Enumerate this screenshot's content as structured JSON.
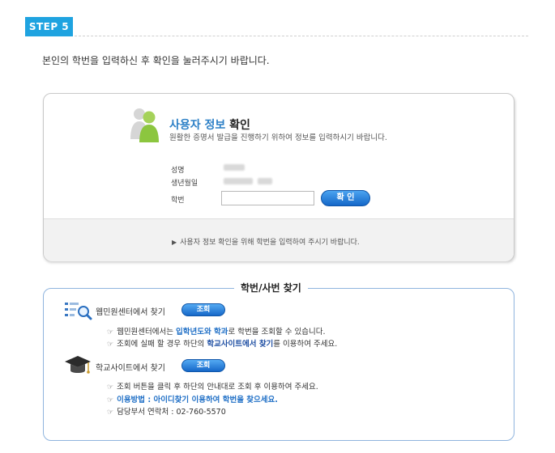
{
  "step": {
    "badge": "STEP 5"
  },
  "intro": "본인의 학번을 입력하신 후 확인을 눌러주시기 바랍니다.",
  "verify": {
    "title_blue": "사용자 정보",
    "title_dark": " 확인",
    "subtitle": "원활한 증명서 발급을 진행하기 위하여 정보를 입력하시기 바랍니다.",
    "name_label": "성명",
    "birth_label": "생년월일",
    "student_no_label": "학번",
    "confirm_button": "확 인",
    "hint": "사용자 정보 확인을 위해 학번을 입력하여 주시기 바랍니다."
  },
  "find": {
    "title": "학번/사번 찾기",
    "webmin": {
      "title": "웹민원센터에서 찾기",
      "button": "조회",
      "line1_a": "웹민원센터에서는 ",
      "line1_b": "입학년도와 학과",
      "line1_c": "로 학번을 조회할 수 있습니다.",
      "line2_a": "조회에 실패 할 경우 하단의 ",
      "line2_b": "학교사이트에서 찾기",
      "line2_c": "를 이용하여 주세요."
    },
    "school": {
      "title": "학교사이트에서 찾기",
      "button": "조회",
      "line1": "조회 버튼을 클릭 후 하단의 안내대로 조회 후 이용하여 주세요.",
      "line2": "이용방법 : 아이디찾기 이용하여 학번을 찾으세요.",
      "line3": "담당부서 연락처 : 02-760-5570"
    }
  },
  "colors": {
    "accent": "#1fa3e0",
    "button_blue": "#1467c8",
    "title_blue": "#2b7fc6",
    "box_border": "#8fb4de"
  }
}
